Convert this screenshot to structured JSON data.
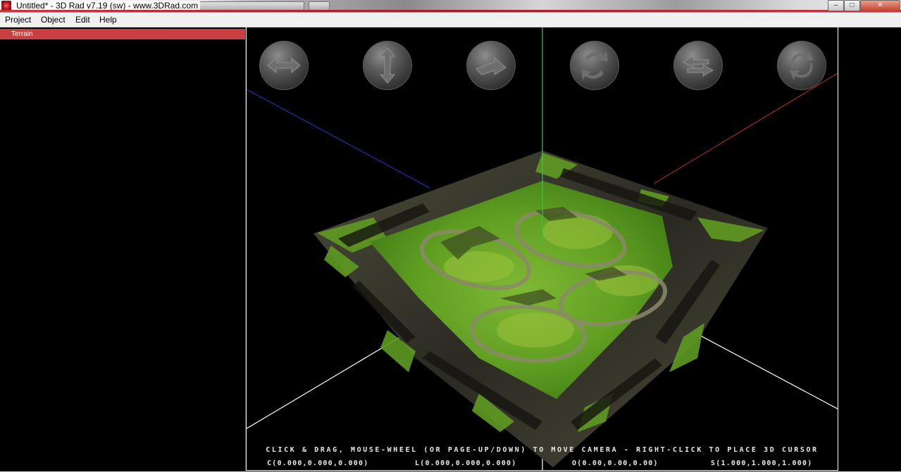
{
  "window": {
    "title": "Untitled* - 3D Rad v7.19 (sw) - www.3DRad.com",
    "controls": {
      "minimize": "–",
      "maximize": "□",
      "close": "✕"
    }
  },
  "menu": {
    "items": [
      "Project",
      "Object",
      "Edit",
      "Help"
    ]
  },
  "object_list": {
    "items": [
      {
        "label": "Terrain",
        "selected": true
      }
    ]
  },
  "viewport": {
    "camera_buttons": [
      {
        "icon": "pan-horizontal-icon"
      },
      {
        "icon": "pan-vertical-icon"
      },
      {
        "icon": "move-forward-icon"
      },
      {
        "icon": "rotate-vertical-icon"
      },
      {
        "icon": "rotate-horizontal-icon"
      },
      {
        "icon": "rotate-roll-icon"
      }
    ],
    "hint": "CLICK & DRAG, MOUSE-WHEEL (OR PAGE-UP/DOWN) TO MOVE CAMERA - RIGHT-CLICK TO PLACE 3D CURSOR",
    "coords": {
      "c": "C(0.000,0.000,0.000)",
      "l": "L(0.000,0.000,0.000)",
      "o": "O(0.00,0.00,0.00)",
      "s": "S(1.000,1.000,1.000)"
    },
    "colors": {
      "axis_x": "#c0392b",
      "axis_y": "#2ecc40",
      "axis_z": "#2a3ac0",
      "grass": "#6aa526",
      "rock": "#3b3a30",
      "path": "#8a8a6a"
    }
  }
}
